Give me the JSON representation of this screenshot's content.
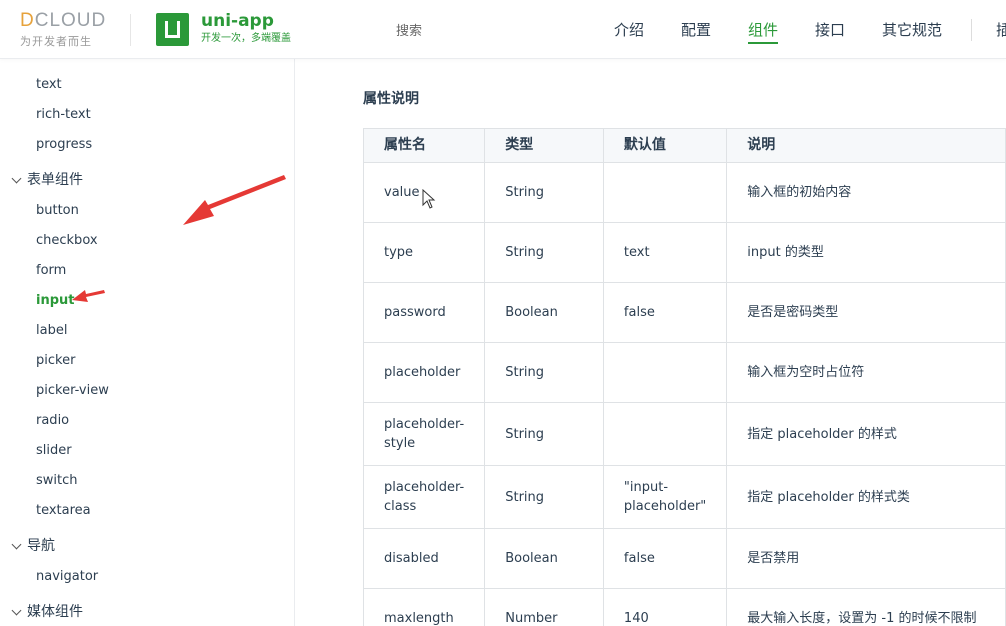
{
  "header": {
    "dcloud_brand_d": "D",
    "dcloud_brand_rest": "CLOUD",
    "dcloud_tagline": "为开发者而生",
    "app_title": "uni-app",
    "app_tagline": "开发一次，多端覆盖",
    "search_placeholder": "搜索",
    "nav": [
      "介绍",
      "配置",
      "组件",
      "接口",
      "其它规范",
      "插"
    ],
    "active_nav": "组件"
  },
  "sidebar": {
    "items": [
      {
        "type": "item",
        "label": "text"
      },
      {
        "type": "item",
        "label": "rich-text"
      },
      {
        "type": "item",
        "label": "progress"
      },
      {
        "type": "group",
        "label": "表单组件"
      },
      {
        "type": "item",
        "label": "button"
      },
      {
        "type": "item",
        "label": "checkbox"
      },
      {
        "type": "item",
        "label": "form"
      },
      {
        "type": "item",
        "label": "input",
        "active": true
      },
      {
        "type": "item",
        "label": "label"
      },
      {
        "type": "item",
        "label": "picker"
      },
      {
        "type": "item",
        "label": "picker-view"
      },
      {
        "type": "item",
        "label": "radio"
      },
      {
        "type": "item",
        "label": "slider"
      },
      {
        "type": "item",
        "label": "switch"
      },
      {
        "type": "item",
        "label": "textarea"
      },
      {
        "type": "group",
        "label": "导航"
      },
      {
        "type": "item",
        "label": "navigator"
      },
      {
        "type": "group",
        "label": "媒体组件"
      }
    ]
  },
  "content": {
    "faded_text": "—— ——",
    "section_title": "属性说明",
    "table": {
      "headers": [
        "属性名",
        "类型",
        "默认值",
        "说明"
      ],
      "rows": [
        [
          "value",
          "String",
          "",
          "输入框的初始内容"
        ],
        [
          "type",
          "String",
          "text",
          "input 的类型"
        ],
        [
          "password",
          "Boolean",
          "false",
          "是否是密码类型"
        ],
        [
          "placeholder",
          "String",
          "",
          "输入框为空时占位符"
        ],
        [
          "placeholder-style",
          "String",
          "",
          "指定 placeholder 的样式"
        ],
        [
          "placeholder-class",
          "String",
          "\"input-placeholder\"",
          "指定 placeholder 的样式类"
        ],
        [
          "disabled",
          "Boolean",
          "false",
          "是否禁用"
        ],
        [
          "maxlength",
          "Number",
          "140",
          "最大输入长度，设置为 -1 的时候不限制"
        ]
      ]
    }
  },
  "colors": {
    "brand_green": "#2b9939",
    "annotation_red": "#e53935",
    "table_border": "#dfe2e5"
  }
}
